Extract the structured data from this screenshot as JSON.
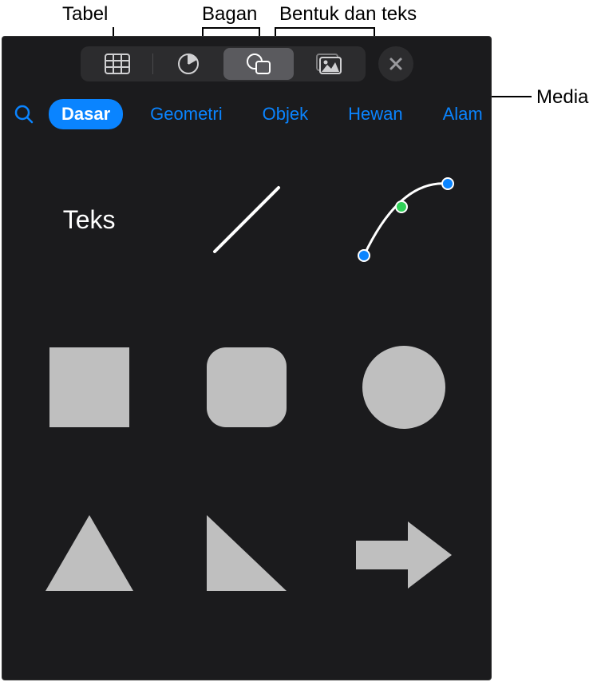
{
  "callouts": {
    "tabel": "Tabel",
    "bagan": "Bagan",
    "bentuk_teks": "Bentuk dan teks",
    "media": "Media"
  },
  "toolbar": {
    "tabs": {
      "tabel": "table-icon",
      "bagan": "chart-icon",
      "shapes": "shapes-icon",
      "media": "media-icon"
    },
    "active_tab": "shapes",
    "close": "close"
  },
  "categories": {
    "items": [
      {
        "label": "Dasar",
        "active": true
      },
      {
        "label": "Geometri",
        "active": false
      },
      {
        "label": "Objek",
        "active": false
      },
      {
        "label": "Hewan",
        "active": false
      },
      {
        "label": "Alam",
        "active": false
      }
    ]
  },
  "shapes": {
    "teks_label": "Teks",
    "items": [
      "text",
      "line",
      "curve",
      "square",
      "rounded-square",
      "circle",
      "triangle",
      "right-triangle",
      "arrow-right"
    ]
  },
  "colors": {
    "shape_fill": "#bfbfbf",
    "accent": "#0a84ff",
    "panel_bg": "#1b1b1d"
  }
}
